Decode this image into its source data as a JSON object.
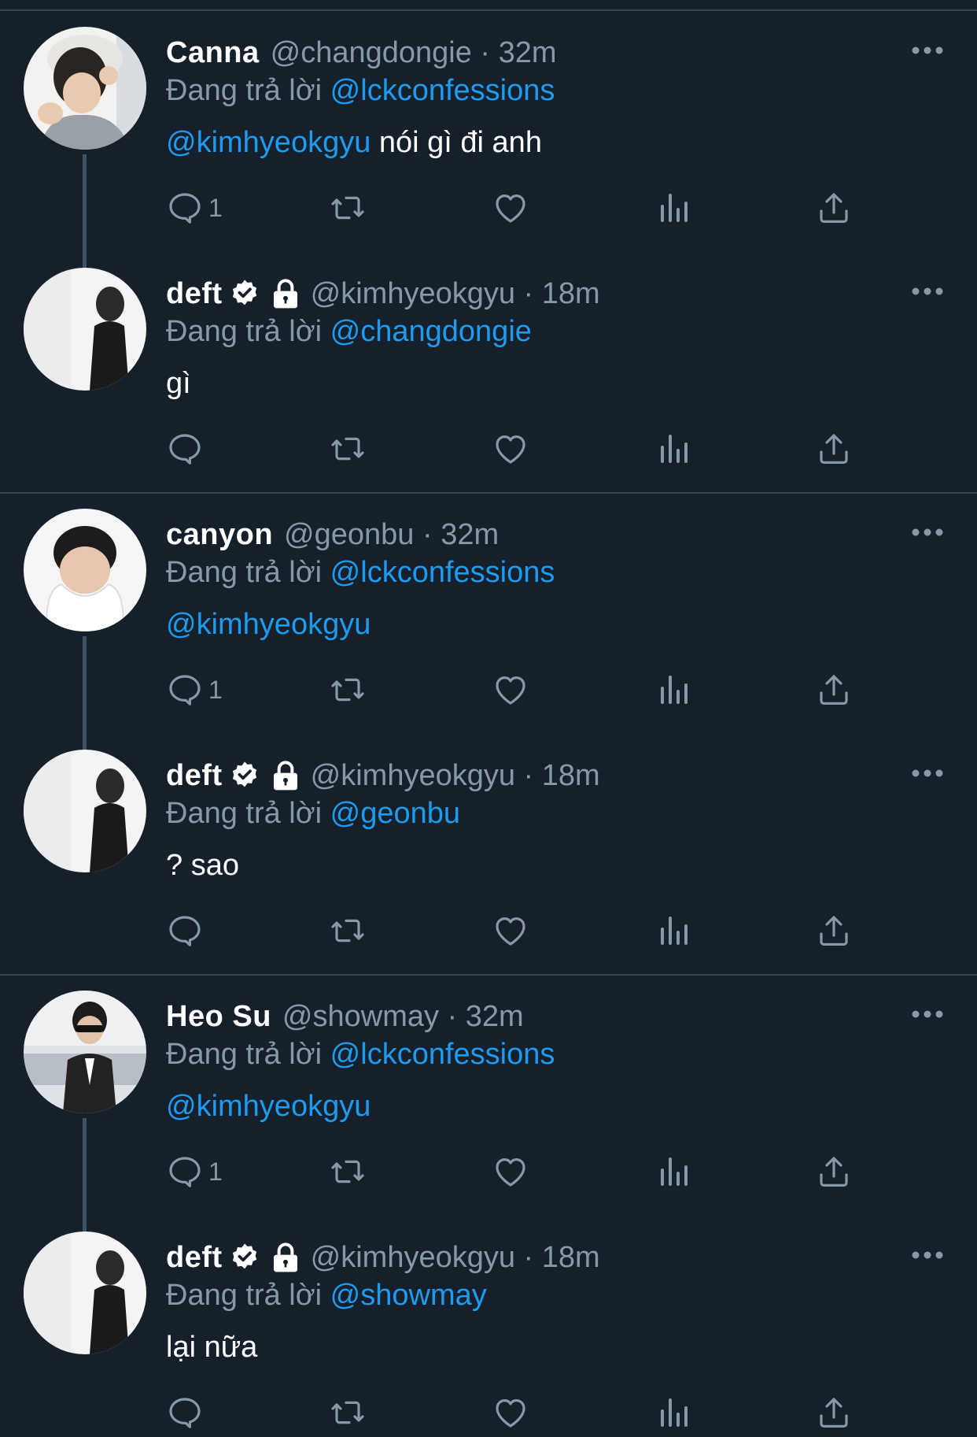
{
  "tweets": [
    {
      "name": "Canna",
      "handle": "@changdongie",
      "time": "32m",
      "reply_prefix": "Đang trả lời",
      "reply_to": "@lckconfessions",
      "mention": "@kimhyeokgyu",
      "text": " nói gì đi anh",
      "reply_count": "1",
      "verified": false,
      "locked": false
    },
    {
      "name": "deft",
      "handle": "@kimhyeokgyu",
      "time": "18m",
      "reply_prefix": "Đang trả lời",
      "reply_to": "@changdongie",
      "mention": "",
      "text": "gì",
      "reply_count": "",
      "verified": true,
      "locked": true
    },
    {
      "name": "canyon",
      "handle": "@geonbu",
      "time": "32m",
      "reply_prefix": "Đang trả lời",
      "reply_to": "@lckconfessions",
      "mention": "@kimhyeokgyu",
      "text": "",
      "reply_count": "1",
      "verified": false,
      "locked": false
    },
    {
      "name": "deft",
      "handle": "@kimhyeokgyu",
      "time": "18m",
      "reply_prefix": "Đang trả lời",
      "reply_to": "@geonbu",
      "mention": "",
      "text": "? sao",
      "reply_count": "",
      "verified": true,
      "locked": true
    },
    {
      "name": "Heo Su",
      "handle": "@showmay",
      "time": "32m",
      "reply_prefix": "Đang trả lời",
      "reply_to": "@lckconfessions",
      "mention": "@kimhyeokgyu",
      "text": "",
      "reply_count": "1",
      "verified": false,
      "locked": false
    },
    {
      "name": "deft",
      "handle": "@kimhyeokgyu",
      "time": "18m",
      "reply_prefix": "Đang trả lời",
      "reply_to": "@showmay",
      "mention": "",
      "text": "lại nữa",
      "reply_count": "",
      "verified": true,
      "locked": true
    }
  ],
  "separator": " · ",
  "colors": {
    "background": "#15202b",
    "secondary_text": "#8899a6",
    "link": "#1d9bf0",
    "divider": "#38444d"
  },
  "icons": [
    "reply-icon",
    "retweet-icon",
    "like-icon",
    "analytics-icon",
    "share-icon",
    "more-icon",
    "verified-badge-icon",
    "lock-icon"
  ]
}
